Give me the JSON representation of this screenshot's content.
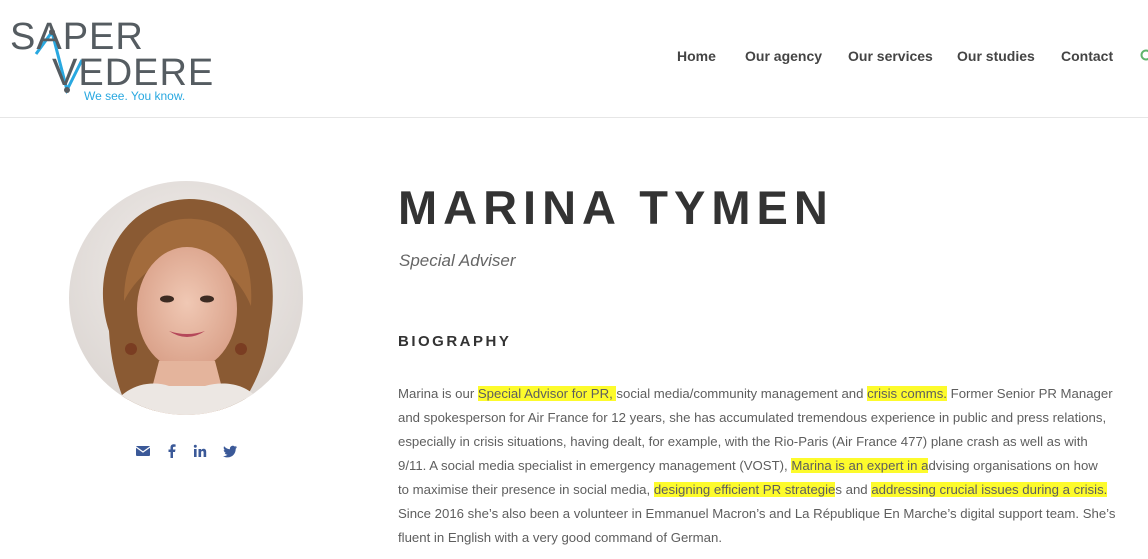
{
  "header": {
    "logo": {
      "word_top": "SAPER",
      "word_bottom": "VEDERE",
      "tagline": "We see. You know."
    },
    "nav": [
      {
        "label": "Home"
      },
      {
        "label": "Our agency"
      },
      {
        "label": "Our services"
      },
      {
        "label": "Our studies"
      },
      {
        "label": "Contact"
      }
    ],
    "search_icon": "search-icon"
  },
  "profile": {
    "name": "MARINA TYMEN",
    "role": "Special Adviser",
    "social": [
      {
        "icon": "envelope-icon"
      },
      {
        "icon": "facebook-icon"
      },
      {
        "icon": "linkedin-icon"
      },
      {
        "icon": "twitter-icon"
      }
    ]
  },
  "biography": {
    "heading": "BIOGRAPHY",
    "highlight_color": "#fdfb2c",
    "lines": [
      [
        "Marina is our ",
        "Special Advisor for PR, ",
        "social media/community management and ",
        "crisis comms.",
        " Former Senior PR Manager"
      ],
      [
        "and spokesperson for Air France for 12 years, she has accumulated tremendous experience in public and press relations,"
      ],
      [
        "especially in crisis situations, having dealt, for example, with the Rio-Paris (Air France 477) plane crash as well as with"
      ],
      [
        "9/11. A social media specialist in emergency management (VOST), ",
        "Marina is an expert in a",
        "dvising organisations on how"
      ],
      [
        "to maximise their presence in social media, ",
        "designing efficient PR strategie",
        "s and ",
        "addressing crucial issues during a crisis.",
        ""
      ],
      [
        "Since 2016 she’s also been a volunteer in Emmanuel Macron’s and La République En Marche’s digital support team. She’s"
      ],
      [
        "fluent in English with a very good command of German."
      ]
    ]
  },
  "colors": {
    "accent_blue": "#29a8e0",
    "text_dark": "#333333",
    "social_blue": "#3b5998"
  }
}
